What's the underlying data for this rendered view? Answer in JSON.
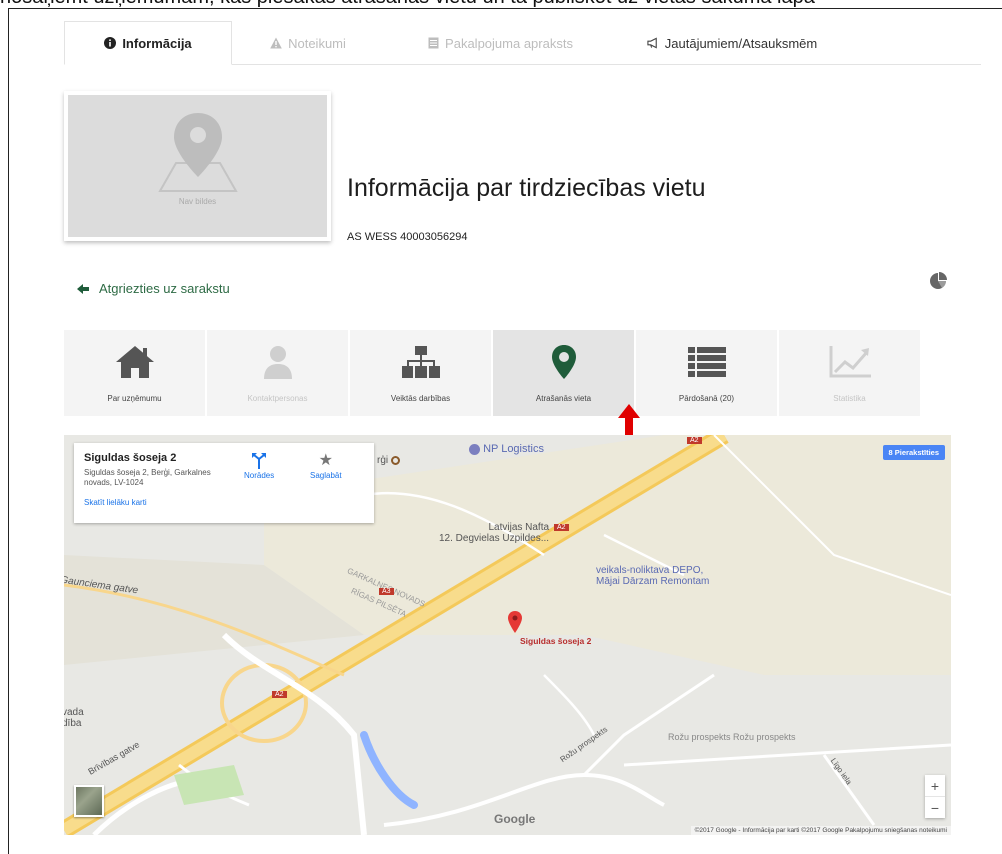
{
  "top_caption": "nosaņemt uzņēmumam, kas piesakās atrašanās vietu un tā publiskot uz vietas sākuma lapā",
  "tabs": [
    {
      "label": "Informācija",
      "icon": "info-icon",
      "active": true
    },
    {
      "label": "Noteikumi",
      "icon": "warning-icon",
      "active": false
    },
    {
      "label": "Pakalpojuma apraksts",
      "icon": "document-icon",
      "active": false
    },
    {
      "label": "Jautājumiem/Atsauksmēm",
      "icon": "megaphone-icon",
      "active": false
    }
  ],
  "photo": {
    "placeholder": "Nav bildes",
    "icon": "map-pin-placeholder-icon"
  },
  "page_title": "Informācija par tirdziecības vietu",
  "company": "AS WESS 40003056294",
  "back_link": {
    "label": "Atgriezties uz sarakstu",
    "icon": "arrow-left-icon"
  },
  "stats_icon": "pie-chart-icon",
  "nav": [
    {
      "label": "Par uzņēmumu",
      "icon": "home-icon",
      "state": "normal"
    },
    {
      "label": "Kontaktpersonas",
      "icon": "person-icon",
      "state": "disabled"
    },
    {
      "label": "Veiktās darbības",
      "icon": "org-chart-icon",
      "state": "normal"
    },
    {
      "label": "Atrašanās vieta",
      "icon": "location-pin-icon",
      "state": "active"
    },
    {
      "label": "Pārdošanā (20)",
      "icon": "list-icon",
      "state": "normal"
    },
    {
      "label": "Statistika",
      "icon": "line-chart-icon",
      "state": "disabled"
    }
  ],
  "colors": {
    "accent_green": "#1f5c3a",
    "annotation_red": "#e00000",
    "link_blue": "#1a73e8"
  },
  "map": {
    "card": {
      "title": "Siguldas šoseja 2",
      "address": "Siguldas šoseja 2, Berģi, Garkalnes novads, LV-1024",
      "link": "Skatīt lielāku karti",
      "directions": "Norādes",
      "save": "Saglabāt"
    },
    "signin": "Pierakstīties",
    "labels": {
      "np_logistics": "NP Logistics",
      "bergi": "rģi",
      "latvijas_nafta": "Latvijas Nafta\n12. Degvielas Uzpildes...",
      "depo": "veikals-noliktava DEPO,\nMājai Dārzam Remontam",
      "garkalnes": "GARKALNES NOVADS",
      "rigas": "RĪGAS PILSĒTA",
      "gauncieme": "Gaunciema gatve",
      "pin": "Siguldas šoseja 2",
      "brivibas": "Brīvības gatve",
      "rozu1": "Rožu prospekts",
      "rozu2": "Rožu prospekts  Rožu prospekts",
      "ligo": "Līgo iela",
      "novada": "vada\ndība",
      "a2a": "A2",
      "a2b": "A2",
      "a2c": "A2",
      "a3": "A3"
    },
    "google": "Google",
    "footer": "©2017 Google - Informācija par karti ©2017 Google   Pakalpojumu sniegšanas noteikumi",
    "zoom_in": "+",
    "zoom_out": "−"
  }
}
